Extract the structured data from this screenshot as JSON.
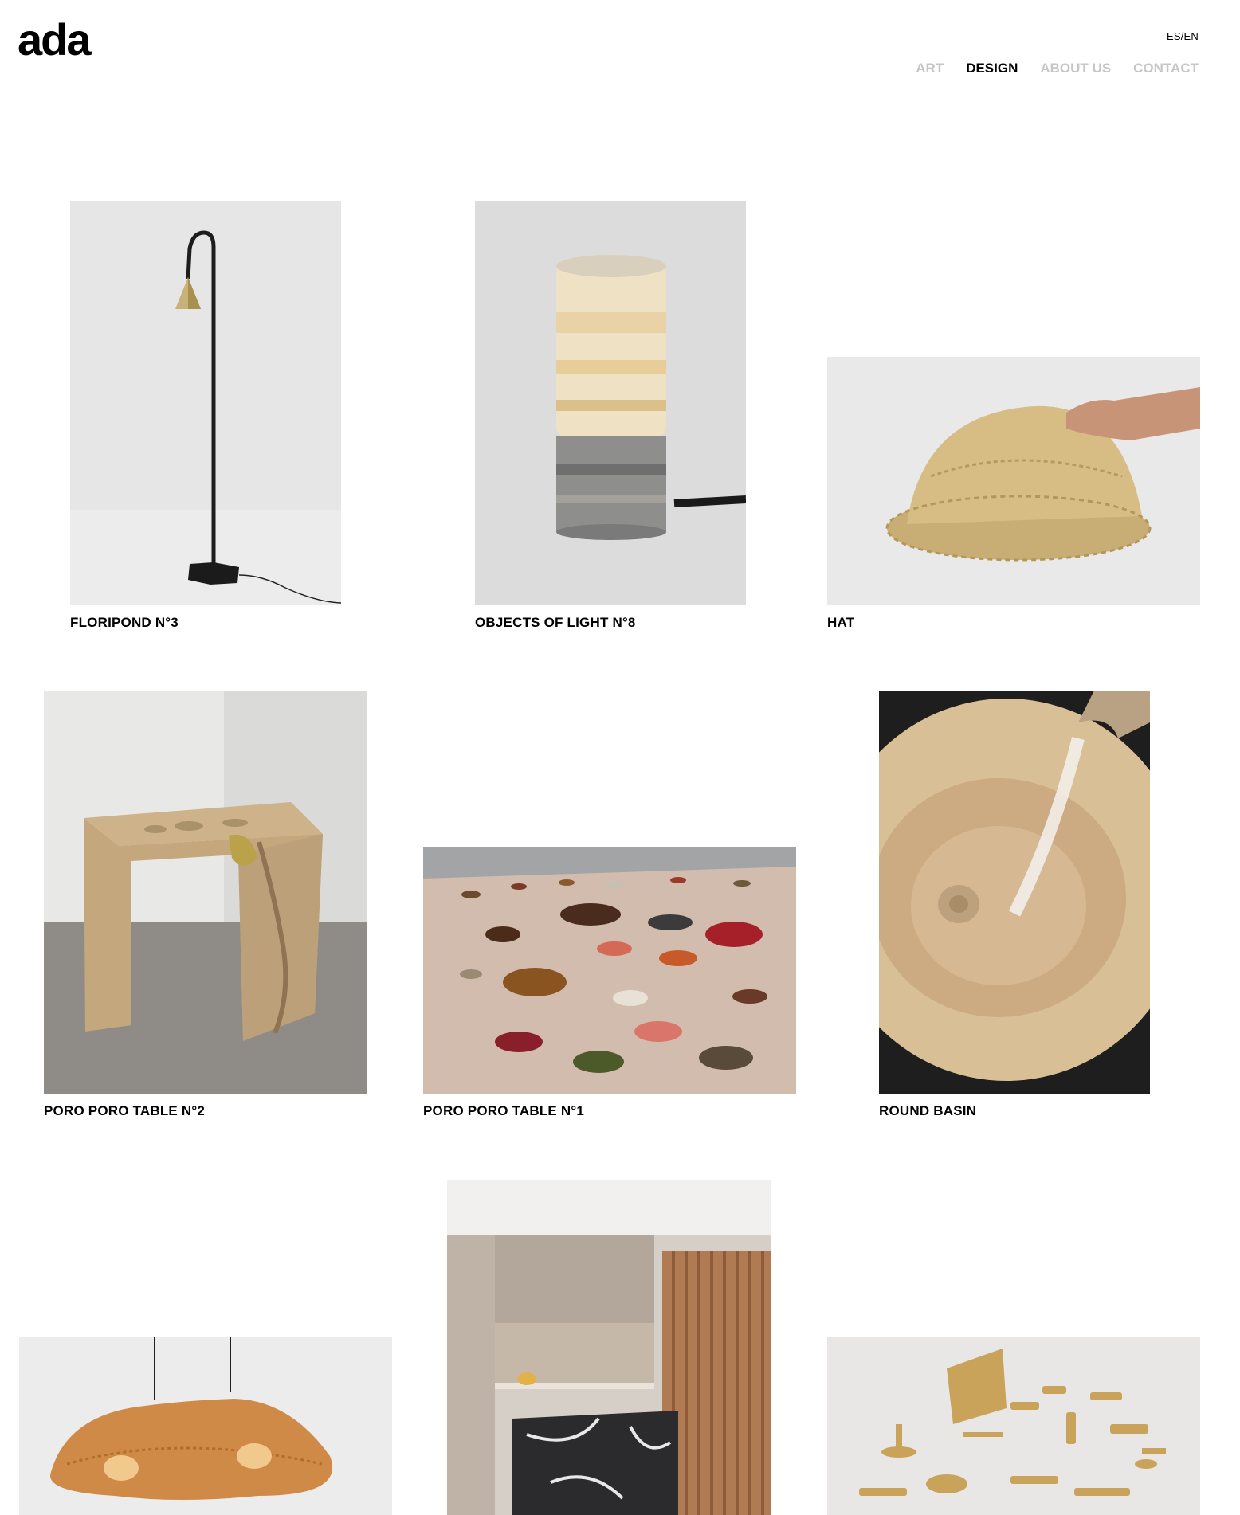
{
  "brand": {
    "logo": "ada"
  },
  "header": {
    "lang_switch": "ES/EN",
    "nav": [
      "ART",
      "DESIGN",
      "ABOUT US",
      "CONTACT"
    ],
    "active": "DESIGN"
  },
  "products": [
    {
      "title": "FLORIPOND N°3"
    },
    {
      "title": "OBJECTS OF LIGHT N°8"
    },
    {
      "title": "HAT"
    },
    {
      "title": "PORO PORO TABLE N°2"
    },
    {
      "title": "PORO PORO TABLE N°1"
    },
    {
      "title": "ROUND BASIN"
    },
    {
      "title": ""
    },
    {
      "title": ""
    },
    {
      "title": ""
    }
  ],
  "colors": {
    "nav_inactive": "#c6c6c6",
    "nav_active": "#000000"
  }
}
